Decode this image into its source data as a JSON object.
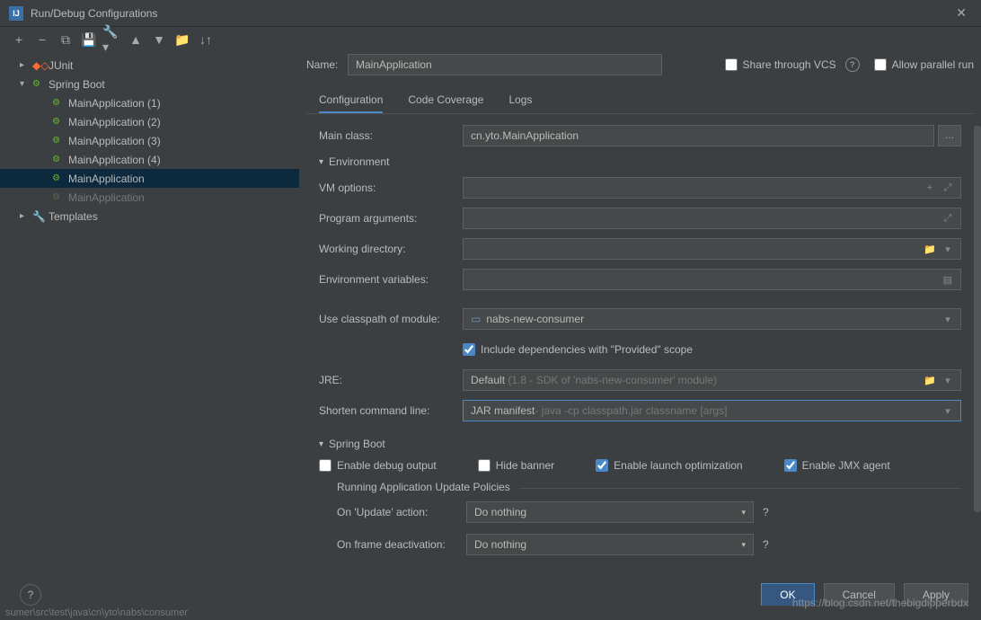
{
  "title": "Run/Debug Configurations",
  "sidebar": {
    "junit": {
      "label": "JUnit"
    },
    "spring": {
      "label": "Spring Boot"
    },
    "items": [
      {
        "label": "MainApplication (1)"
      },
      {
        "label": "MainApplication (2)"
      },
      {
        "label": "MainApplication (3)"
      },
      {
        "label": "MainApplication (4)"
      },
      {
        "label": "MainApplication"
      },
      {
        "label": "MainApplication"
      }
    ],
    "templates": {
      "label": "Templates"
    }
  },
  "form": {
    "name_label": "Name:",
    "name_value": "MainApplication",
    "share_vcs": "Share through VCS",
    "allow_parallel": "Allow parallel run",
    "tabs": {
      "config": "Configuration",
      "coverage": "Code Coverage",
      "logs": "Logs"
    },
    "main_class_label": "Main class:",
    "main_class": "cn.yto.MainApplication",
    "env_section": "Environment",
    "vm_options": "VM options:",
    "prog_args": "Program arguments:",
    "working_dir": "Working directory:",
    "env_vars": "Environment variables:",
    "classpath_label": "Use classpath of module:",
    "classpath": "nabs-new-consumer",
    "include_deps": "Include dependencies with \"Provided\" scope",
    "jre_label": "JRE:",
    "jre_value": "Default",
    "jre_hint": "(1.8 - SDK of 'nabs-new-consumer' module)",
    "shorten_label": "Shorten command line:",
    "shorten_val": "JAR manifest",
    "shorten_hint": " - java -cp classpath.jar classname [args]",
    "spring_section": "Spring Boot",
    "enable_debug": "Enable debug output",
    "hide_banner": "Hide banner",
    "enable_launch": "Enable launch optimization",
    "enable_jmx": "Enable JMX agent",
    "policies_label": "Running Application Update Policies",
    "on_update_label": "On 'Update' action:",
    "on_update_val": "Do nothing",
    "on_frame_label": "On frame deactivation:",
    "on_frame_val": "Do nothing"
  },
  "footer": {
    "ok": "OK",
    "cancel": "Cancel",
    "apply": "Apply"
  },
  "status": "sumer\\src\\test\\java\\cn\\yto\\nabs\\consumer",
  "watermark": "https://blog.csdn.net/thebigdipperbdx"
}
